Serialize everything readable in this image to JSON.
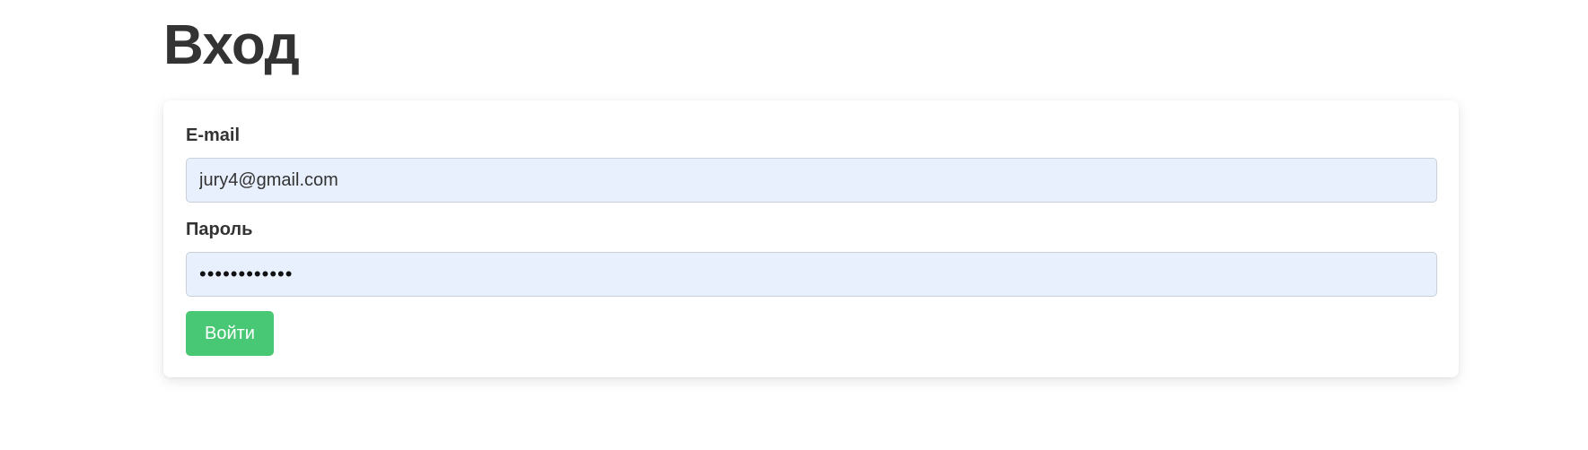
{
  "page": {
    "title": "Вход"
  },
  "login_form": {
    "email_label": "E-mail",
    "email_value": "jury4@gmail.com",
    "password_label": "Пароль",
    "password_value": "••••••••••••",
    "submit_label": "Войти"
  },
  "colors": {
    "input_background": "#e8f0fe",
    "button_background": "#48c774",
    "text": "#333333"
  }
}
